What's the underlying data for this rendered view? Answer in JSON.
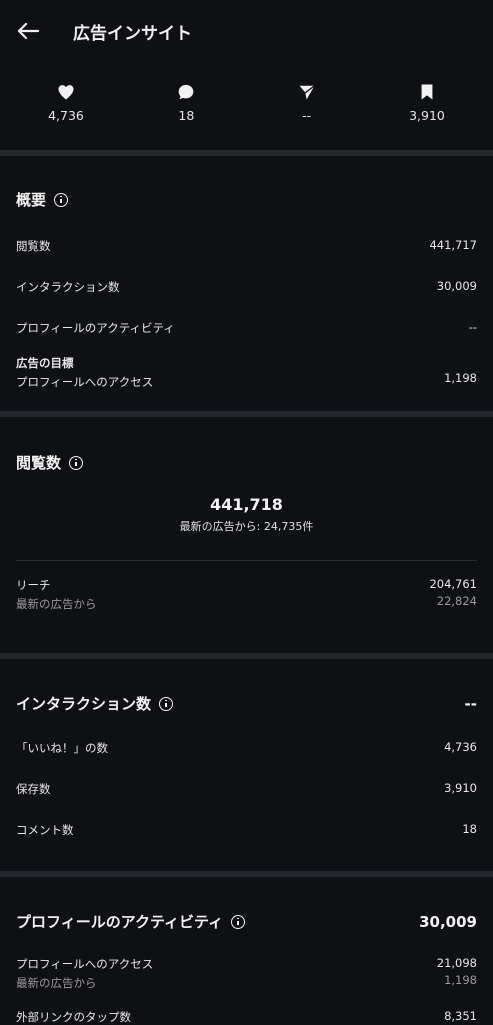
{
  "header": {
    "title": "広告インサイト"
  },
  "stats": [
    {
      "icon": "heart-icon",
      "value": "4,736"
    },
    {
      "icon": "comment-icon",
      "value": "18"
    },
    {
      "icon": "share-icon",
      "value": "--"
    },
    {
      "icon": "bookmark-icon",
      "value": "3,910"
    }
  ],
  "overview": {
    "title": "概要",
    "rows": [
      {
        "label": "閲覧数",
        "value": "441,717"
      },
      {
        "label": "インタラクション数",
        "value": "30,009"
      },
      {
        "label": "プロフィールのアクティビティ",
        "value": "--"
      }
    ],
    "goal": {
      "heading": "広告の目標",
      "label": "プロフィールへのアクセス",
      "value": "1,198"
    }
  },
  "views": {
    "title": "閲覧数",
    "total": "441,718",
    "total_sub": "最新の広告から: 24,735件",
    "reach_label": "リーチ",
    "reach_sub": "最新の広告から",
    "reach_value": "204,761",
    "reach_sub_value": "22,824"
  },
  "interactions": {
    "title": "インタラクション数",
    "value": "--",
    "rows": [
      {
        "label": "「いいね！」の数",
        "value": "4,736"
      },
      {
        "label": "保存数",
        "value": "3,910"
      },
      {
        "label": "コメント数",
        "value": "18"
      }
    ]
  },
  "profile_activity": {
    "title": "プロフィールのアクティビティ",
    "value": "30,009",
    "rows": [
      {
        "label": "プロフィールへのアクセス",
        "sub": "最新の広告から",
        "value": "21,098",
        "sub_value": "1,198"
      },
      {
        "label": "外部リンクのタップ数",
        "value": "8,351"
      }
    ]
  }
}
